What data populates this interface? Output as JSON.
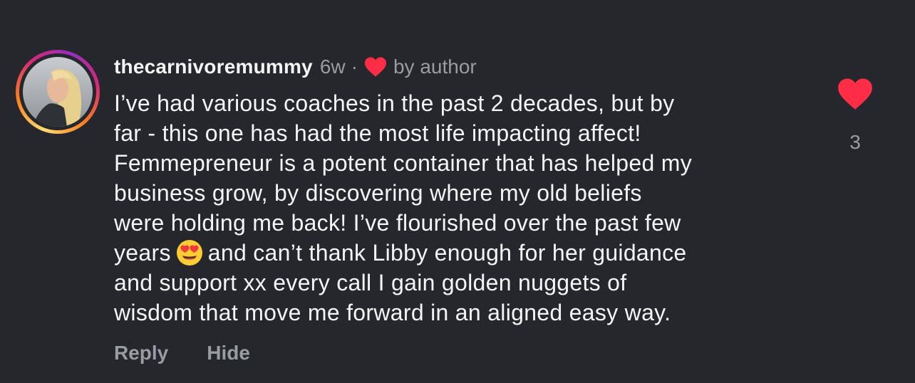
{
  "comment": {
    "username": "thecarnivoremummy",
    "timestamp": "6w",
    "separator": "·",
    "liked_by": "by author",
    "body_lines": [
      "I’ve had various coaches in the past 2 decades, but by",
      "far - this one has had the most life impacting affect!",
      "Femmepreneur is a potent container that has helped my",
      "business grow, by discovering where my old beliefs",
      "were holding me back! I’ve flourished over the past few"
    ],
    "body_line6_before": "years",
    "body_line6_after": "and can’t thank Libby enough for her guidance",
    "body_lines_end": [
      "and support xx every call I gain golden nuggets of",
      "wisdom that move me forward in an aligned easy way."
    ],
    "emoji": "heart-eyes-emoji",
    "actions": {
      "reply": "Reply",
      "hide": "Hide"
    },
    "like_count": "3"
  },
  "colors": {
    "background": "#25272c",
    "text": "#f5f5f7",
    "muted": "#9a9ca3",
    "heart": "#ff2d45"
  }
}
